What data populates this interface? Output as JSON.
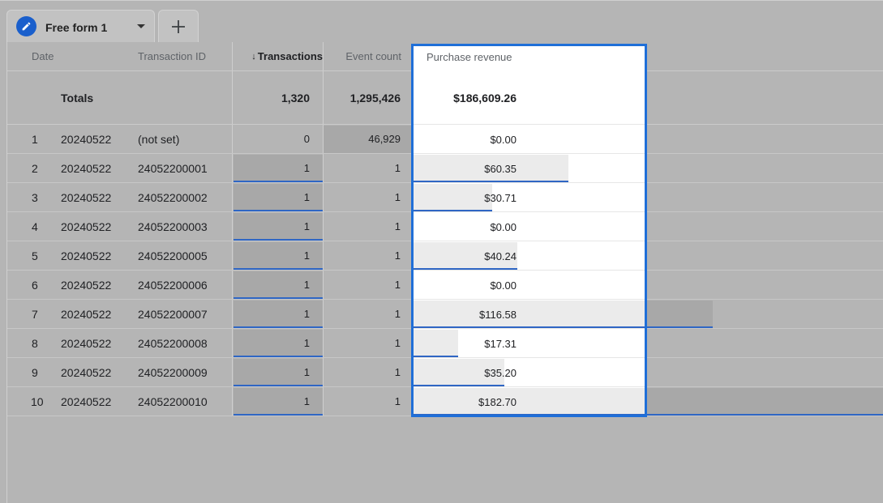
{
  "tab": {
    "label": "Free form 1",
    "icon": "pencil-icon",
    "dropdown_icon": "caret-down-icon"
  },
  "add_tab": {
    "icon": "plus-icon"
  },
  "columns": {
    "date": "Date",
    "transaction_id": "Transaction ID",
    "transactions": "Transactions",
    "event_count": "Event count",
    "purchase_revenue": "Purchase revenue"
  },
  "sort_indicator": "↓",
  "totals": {
    "label": "Totals",
    "transactions": "1,320",
    "event_count": "1,295,426",
    "purchase_revenue": "$186,609.26"
  },
  "rows": [
    {
      "num": "1",
      "date": "20240522",
      "tid": "(not set)",
      "transactions": "0",
      "events": "46,929",
      "revenue": "$0.00",
      "revenue_value": 0.0
    },
    {
      "num": "2",
      "date": "20240522",
      "tid": "24052200001",
      "transactions": "1",
      "events": "1",
      "revenue": "$60.35",
      "revenue_value": 60.35
    },
    {
      "num": "3",
      "date": "20240522",
      "tid": "24052200002",
      "transactions": "1",
      "events": "1",
      "revenue": "$30.71",
      "revenue_value": 30.71
    },
    {
      "num": "4",
      "date": "20240522",
      "tid": "24052200003",
      "transactions": "1",
      "events": "1",
      "revenue": "$0.00",
      "revenue_value": 0.0
    },
    {
      "num": "5",
      "date": "20240522",
      "tid": "24052200005",
      "transactions": "1",
      "events": "1",
      "revenue": "$40.24",
      "revenue_value": 40.24
    },
    {
      "num": "6",
      "date": "20240522",
      "tid": "24052200006",
      "transactions": "1",
      "events": "1",
      "revenue": "$0.00",
      "revenue_value": 0.0
    },
    {
      "num": "7",
      "date": "20240522",
      "tid": "24052200007",
      "transactions": "1",
      "events": "1",
      "revenue": "$116.58",
      "revenue_value": 116.58
    },
    {
      "num": "8",
      "date": "20240522",
      "tid": "24052200008",
      "transactions": "1",
      "events": "1",
      "revenue": "$17.31",
      "revenue_value": 17.31
    },
    {
      "num": "9",
      "date": "20240522",
      "tid": "24052200009",
      "transactions": "1",
      "events": "1",
      "revenue": "$35.20",
      "revenue_value": 35.2
    },
    {
      "num": "10",
      "date": "20240522",
      "tid": "24052200010",
      "transactions": "1",
      "events": "1",
      "revenue": "$182.70",
      "revenue_value": 182.7
    }
  ],
  "colors": {
    "accent": "#1f6fd8",
    "bar": "#a8a8a8",
    "bar_underline": "#2f66c4",
    "overlay": "#b5b5b5"
  }
}
